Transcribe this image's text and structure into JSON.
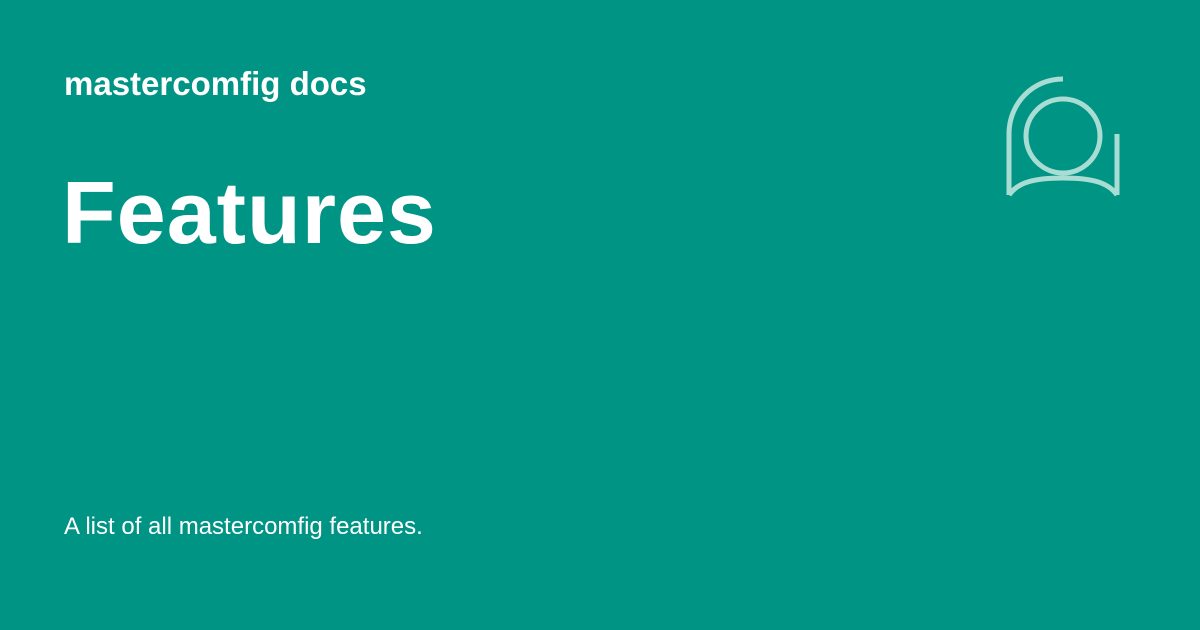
{
  "header": {
    "site_name": "mastercomfig docs"
  },
  "main": {
    "title": "Features",
    "description": "A list of all mastercomfig features."
  },
  "logo": {
    "icon": "mastercomfig-logo-icon",
    "color": "#a9ddd3"
  },
  "theme": {
    "background": "#009485",
    "text": "#ffffff"
  }
}
